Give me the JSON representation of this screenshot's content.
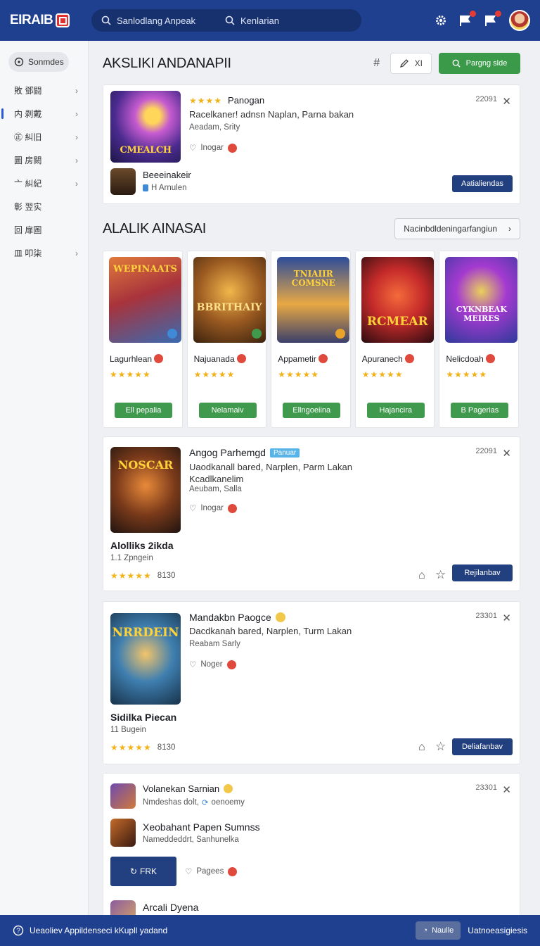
{
  "header": {
    "logo_text": "EIRAIB",
    "search_placeholder_1": "Sanlodlang Anpeak",
    "search_placeholder_2": "Kenlarian"
  },
  "sidebar": {
    "top_label": "Sonmdes",
    "items": [
      {
        "label": "敗 鄧闘",
        "has_chevron": true
      },
      {
        "label": "内 剥戴",
        "has_chevron": true
      },
      {
        "label": "㊣ 糾旧",
        "has_chevron": true
      },
      {
        "label": "圖 房闕",
        "has_chevron": true
      },
      {
        "label": "亠 糾紀",
        "has_chevron": true
      },
      {
        "label": "彰 翌实",
        "has_chevron": false
      },
      {
        "label": "回 扉圖",
        "has_chevron": false
      },
      {
        "label": "皿 叩柒",
        "has_chevron": true
      }
    ]
  },
  "section1": {
    "title": "AKSLIKI ANDANAPII",
    "tool_hash": "#",
    "tool_chip": "XI",
    "green_button": "Pargng slde",
    "card": {
      "id": "22091",
      "title": "Panogan",
      "desc": "Racelkaner! adnsn Naplan, Parna bakan",
      "sub": "Aeadam, Srity",
      "status": "Inogar",
      "thumb_title": "CMEALCH",
      "child_title": "Beeeinakeir",
      "child_sub": "H Arnulen",
      "button": "Aatialiendas"
    }
  },
  "section2": {
    "title": "ALALIK AINASAI",
    "right_button": "Nacinbdldeningarfangiun",
    "games": [
      {
        "thumb_title": "WEPINAATS",
        "name": "Lagurhlean",
        "button": "Ell pepalia"
      },
      {
        "thumb_title": "BBRITHAIY",
        "name": "Najuanada",
        "button": "Nelamaiv"
      },
      {
        "thumb_title": "TNIAIIR COMSNE",
        "name": "Appametir",
        "button": "Ellngoeiina"
      },
      {
        "thumb_title": "RCMEAR",
        "name": "Apuranech",
        "button": "Hajancira"
      },
      {
        "thumb_title": "CYKNBEAK MEIRES",
        "name": "Nelicdoah",
        "button": "B Pagerias"
      }
    ]
  },
  "list_cards": [
    {
      "id": "22091",
      "title": "Angog Parhemgd",
      "badge": "Panuar",
      "desc": "Uaodkanall bared, Narplen, Parm Lakan",
      "sub": "Kcadlkanelim",
      "sub2": "Aeubam, Salla",
      "status": "Inogar",
      "thumb_title": "NOSCAR",
      "name": "Alolliks 2ikda",
      "meta": "1.1 Zpngein",
      "rating": "8130",
      "button": "Rejilanbav"
    },
    {
      "id": "23301",
      "title": "Mandakbn Paogce",
      "badge": "",
      "desc": "Dacdkanah bared, Narplen, Turm Lakan",
      "sub": "Reabam Sarly",
      "sub2": "",
      "status": "Noger",
      "thumb_title": "NRRDEIN",
      "name": "Sidilka Piecan",
      "meta": "11 Bugein",
      "rating": "8130",
      "button": "Deliafanbav"
    }
  ],
  "bottom_card": {
    "id": "23301",
    "row1_title": "Volanekan Sarnian",
    "row1_sub": "Nmdeshas dolt,",
    "row1_sub_b": "oenoemy",
    "row2_title": "Xeobahant Papen Sumnss",
    "row2_sub": "Nameddeddrt, Sanhunelka",
    "blue_button": "FRK",
    "pagee": "Pagees",
    "row3_title": "Arcali Dyena"
  },
  "footer": {
    "left_text": "Ueaoliev Appildenseci kKupll yadand",
    "btn_text": "Naulle",
    "right_text": "Uatnoeasigiesis"
  },
  "colors": {
    "brand": "#1f3f8f",
    "accent_green": "#3b9a4a",
    "navy_button": "#22407f",
    "star": "#f2b21a",
    "alert_red": "#e04a3c"
  }
}
